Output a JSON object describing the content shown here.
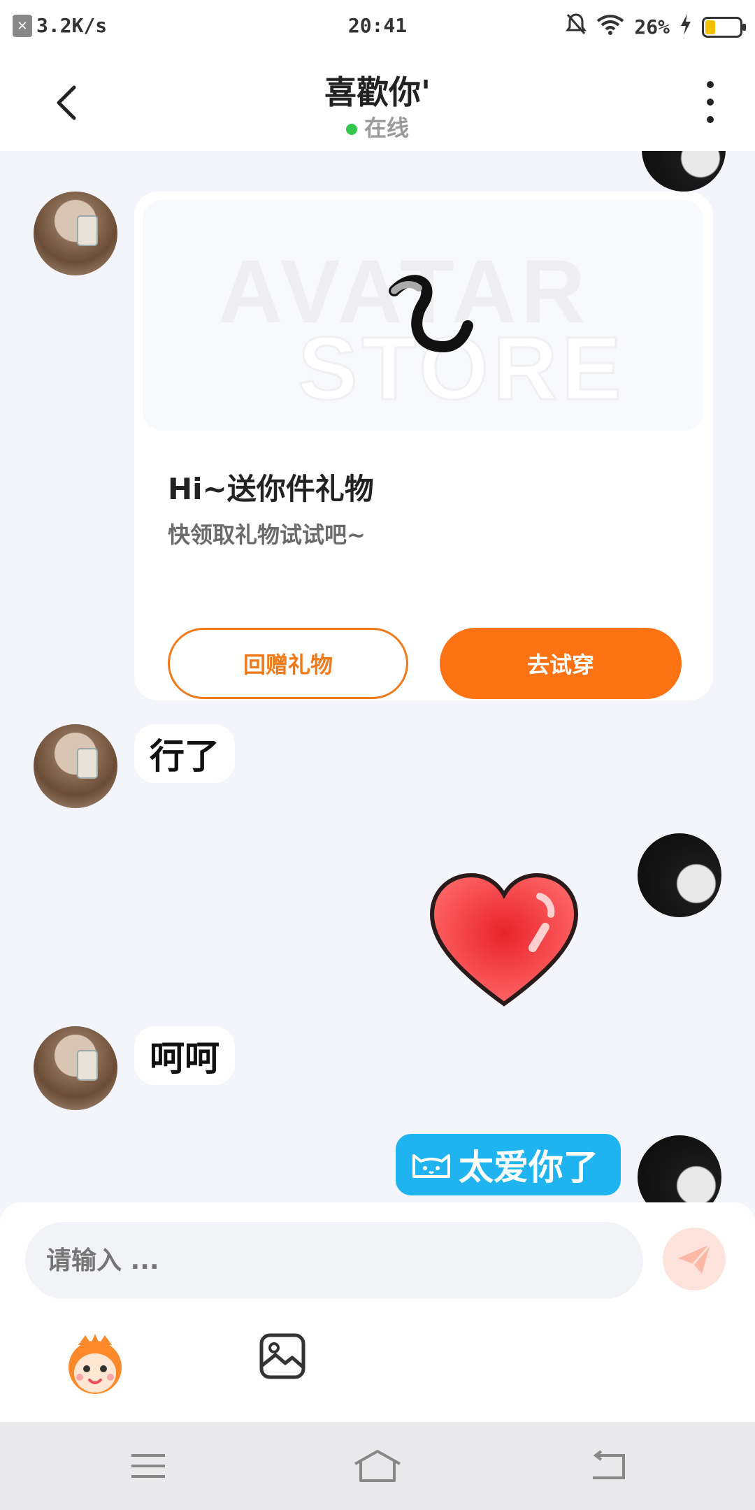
{
  "status_bar": {
    "network_speed": "3.2K/s",
    "time": "20:41",
    "battery": "26%",
    "icons": [
      "close-box-icon",
      "bell-muted-icon",
      "wifi-icon",
      "charging-icon",
      "battery-icon"
    ]
  },
  "header": {
    "title": "喜歡你'",
    "status": "在线",
    "status_color": "#33c84a"
  },
  "messages": [
    {
      "type": "gift_card",
      "side": "left",
      "media_watermark": [
        "AVATAR",
        "STORE"
      ],
      "title": "Hi~送你件礼物",
      "subtitle": "快领取礼物试试吧~",
      "secondary_button": "回赠礼物",
      "primary_button": "去试穿"
    },
    {
      "type": "text",
      "side": "left",
      "text": "行了"
    },
    {
      "type": "sticker",
      "side": "right",
      "sticker": "heart-sticker-icon"
    },
    {
      "type": "text",
      "side": "left",
      "text": "呵呵"
    },
    {
      "type": "text",
      "side": "right",
      "text": "太爱你了",
      "bubble_color": "#1fb3f0"
    }
  ],
  "input": {
    "placeholder": "请输入 ...",
    "send_icon": "send-icon",
    "emoji_icon": "monkey-emoji-icon",
    "image_icon": "image-icon"
  },
  "colors": {
    "accent_orange": "#fd7212",
    "chat_bg": "#f4f5fa"
  }
}
